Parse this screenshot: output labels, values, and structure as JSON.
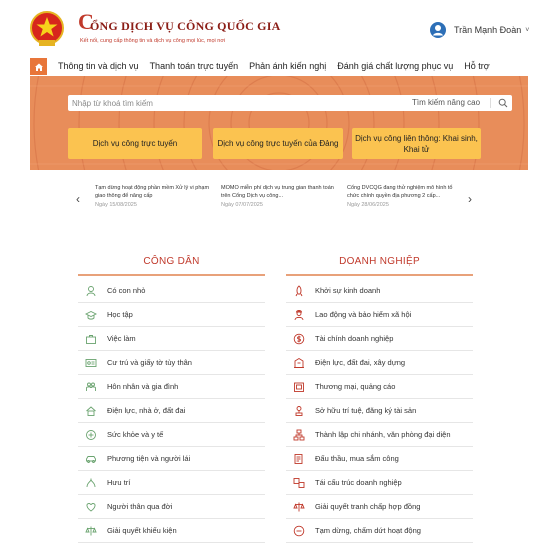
{
  "header": {
    "logo_big": "C",
    "logo_title": "ỔNG DỊCH VỤ CÔNG QUỐC GIA",
    "logo_subtitle": "Kết nối, cung cấp thông tin và dịch vụ công mọi lúc, mọi nơi",
    "user_name": "Trần Mạnh Đoàn",
    "user_caret": "˅"
  },
  "nav": {
    "items": [
      "Thông tin và dịch vụ",
      "Thanh toán trực tuyến",
      "Phản ánh kiến nghị",
      "Đánh giá chất lượng phục vụ",
      "Hỗ trợ"
    ]
  },
  "search": {
    "placeholder": "Nhập từ khoá tìm kiếm",
    "advanced_label": "Tìm kiếm nâng cao"
  },
  "services": [
    "Dịch vụ công trực tuyến",
    "Dịch vụ công trực tuyến của Đảng",
    "Dịch vụ công liên thông: Khai sinh, Khai tử"
  ],
  "news": {
    "prev": "‹",
    "next": "›",
    "items": [
      {
        "title": "Tạm dừng hoạt động phần mềm Xử lý vi phạm giao thông để nâng cấp",
        "date": "Ngày 15/08/2025"
      },
      {
        "title": "MOMO miễn phí dịch vụ trung gian thanh toán trên Cổng Dịch vụ công...",
        "date": "Ngày 07/07/2025"
      },
      {
        "title": "Cổng DVCQG đang thử nghiệm mô hình tổ chức chính quyền địa phương 2 cấp...",
        "date": "Ngày 28/06/2025"
      }
    ]
  },
  "citizen": {
    "title": "CÔNG DÂN",
    "items": [
      "Có con nhỏ",
      "Học tập",
      "Việc làm",
      "Cư trú và giấy tờ tùy thân",
      "Hôn nhân và gia đình",
      "Điện lực, nhà ở, đất đai",
      "Sức khỏe và y tế",
      "Phương tiện và người lái",
      "Hưu trí",
      "Người thân qua đời",
      "Giải quyết khiếu kiện"
    ]
  },
  "business": {
    "title": "DOANH NGHIỆP",
    "items": [
      "Khởi sự kinh doanh",
      "Lao động và bảo hiểm xã hội",
      "Tài chính doanh nghiệp",
      "Điện lực, đất đai, xây dựng",
      "Thương mại, quảng cáo",
      "Sở hữu trí tuệ, đăng ký tài sản",
      "Thành lập chi nhánh, văn phòng đại diện",
      "Đấu thầu, mua sắm công",
      "Tái cấu trúc doanh nghiệp",
      "Giải quyết tranh chấp hợp đồng",
      "Tạm dừng, chấm dứt hoạt động"
    ]
  },
  "colors": {
    "brand_red": "#c0392b",
    "hero_orange": "#e88d5a",
    "button_yellow": "#fbc350",
    "citizen_icon": "#6aa36f"
  },
  "icons": {
    "citizen": [
      "baby-icon",
      "graduation-cap-icon",
      "briefcase-icon",
      "id-card-icon",
      "family-icon",
      "house-icon",
      "health-icon",
      "car-icon",
      "retirement-icon",
      "heart-icon",
      "scales-icon"
    ],
    "business": [
      "rocket-icon",
      "worker-icon",
      "dollar-icon",
      "building-icon",
      "shop-icon",
      "trademark-icon",
      "branch-icon",
      "auction-icon",
      "restructure-icon",
      "contract-icon",
      "stop-icon"
    ]
  }
}
